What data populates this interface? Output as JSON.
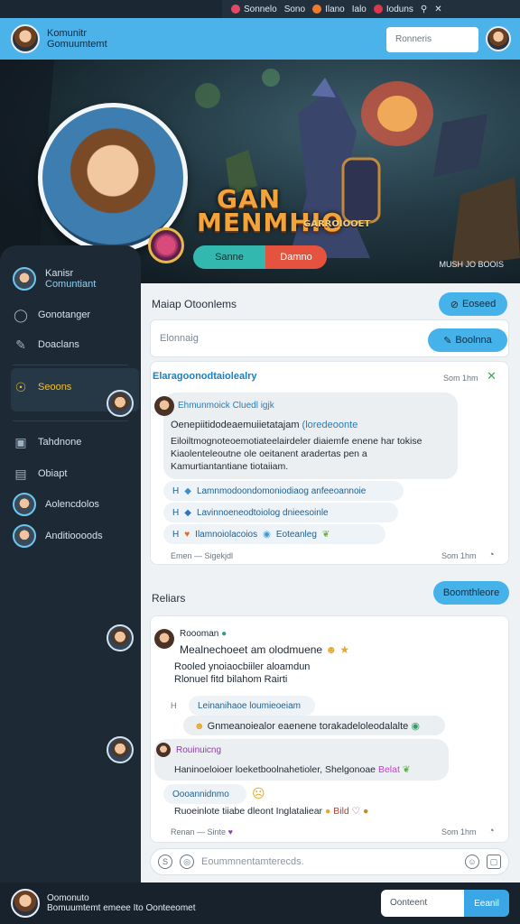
{
  "topbar": {
    "items": [
      "Sonnelo",
      "Sono",
      "Ilano",
      "Ialo",
      "Ioduns"
    ]
  },
  "header": {
    "title": "Komunitr",
    "subtitle": "Gomuumtemt",
    "search_placeholder": "Ronneris"
  },
  "banner": {
    "game_logo_line1": "GAN",
    "game_logo_line2": "MENMHIO",
    "game_logo_sub": "GARROIOOET",
    "button_primary": "Sanne",
    "button_secondary": "Damno",
    "footer": "MUSH JO BOOIS"
  },
  "sidebar": {
    "profile": {
      "name": "Kanisr",
      "role": "Comuntiant"
    },
    "items": [
      {
        "label": "Gonotanger",
        "icon": "chat-icon"
      },
      {
        "label": "Doaclans",
        "icon": "pin-icon"
      },
      {
        "label": "Seoons",
        "icon": "star-icon",
        "active": true
      },
      {
        "label": "Tahdnone",
        "icon": "briefcase-icon"
      },
      {
        "label": "Obiapt",
        "icon": "folder-icon"
      },
      {
        "label": "Aolencdolos"
      },
      {
        "label": "Anditioooods"
      }
    ]
  },
  "main": {
    "section1_title": "Maiap Otoonlems",
    "section1_button": "Eoseed",
    "search_placeholder": "Elonnaig",
    "search_button": "Boolnna",
    "card1": {
      "header": "Elaragoonodtaiolealry",
      "time": "Som 1hm",
      "author": "Ehmunmoick Cluedl igjk",
      "line1a": "Oenepiitidodeaemuiietatajam",
      "line1b": "(loredeoonte",
      "line2": "Eiloiltmognoteoemotiateelairdeler diaiemfe enene har tokise",
      "line3": "Kiaolenteleoutne ole oeitanent aradertas pen a",
      "line4": "Kamurtiantantiane tiotaiiam.",
      "rows": [
        "Lamnmodoondomoniodiaog anfeeoannoie",
        "Lavinnoeneodtoiolog dnieesoinle",
        "Ilamnoiolacoios",
        "Eoteanleg"
      ],
      "footer_left": "Emen — Sigekjdl",
      "footer_right": "Som 1hm"
    },
    "section2_title": "Reliars",
    "section2_button": "Boomthleore",
    "card2": {
      "author": "Roooman",
      "line1": "Mealnechoeet am olodmuene",
      "line2": "Rooled ynoiaocbiiler aloamdun",
      "line3": "Rlonuel fitd bilahom Rairti",
      "reply_chip": "Leinanihaoe loumieoeiam",
      "reply_text": "Gnmeanoiealor eaenene torakadeloleodalalte",
      "author2": "Rouinuicng",
      "line4": "Haninoeloioer loeketboolnahetioler, Shelgonoae",
      "line4b": "Belat",
      "chip2": "Oooannidnmo",
      "line5": "Ruoeinlote tiiabe dleont Inglataliear",
      "line5b": "Bild",
      "footer_left": "Renan — Sinte",
      "footer_right": "Som 1hm"
    },
    "compose_placeholder": "Eoummnentamterecds."
  },
  "bottom": {
    "line1": "Oomonuto",
    "line2": "Bomuumtemt emeee Ito Oonteeomet",
    "field": "Oonteent",
    "button": "Eeanil"
  },
  "colors": {
    "accent": "#46b2ea",
    "header": "#4cb2ea",
    "sidebar": "#1d2a36",
    "danger": "#e5533e",
    "teal": "#33b8b0"
  }
}
